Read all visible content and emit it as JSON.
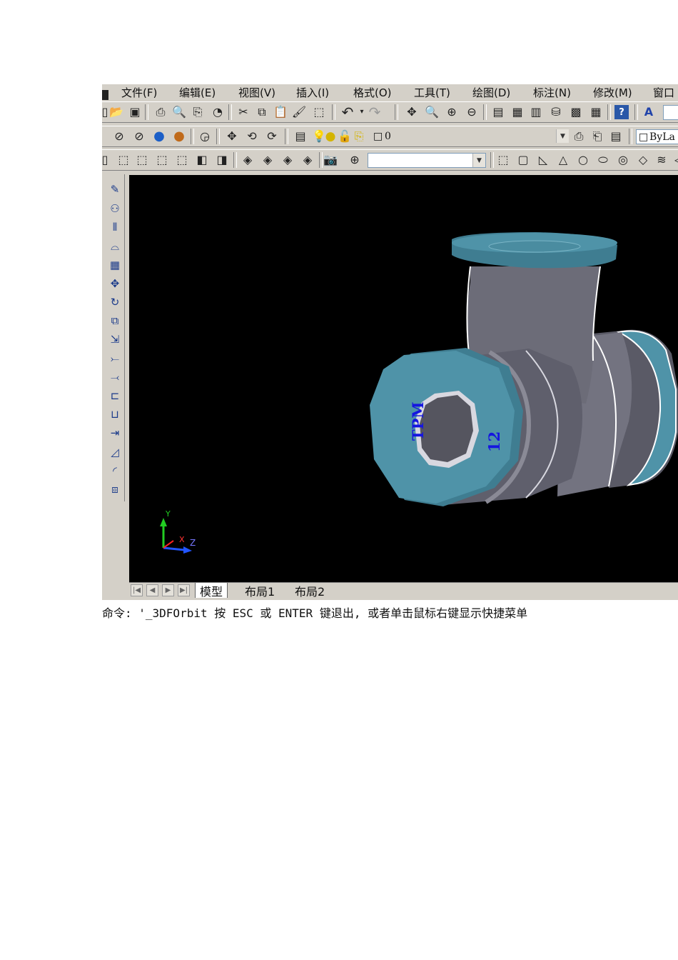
{
  "menu": {
    "items": [
      "文件(F)",
      "编辑(E)",
      "视图(V)",
      "插入(I)",
      "格式(O)",
      "工具(T)",
      "绘图(D)",
      "标注(N)",
      "修改(M)",
      "窗口"
    ]
  },
  "toolbar2": {
    "layer_value": "0",
    "linetype_value": "ByLa"
  },
  "model": {
    "label_tpm": "TPM",
    "label_size": "12"
  },
  "ucs": {
    "x": "X",
    "y": "Y",
    "z": "Z"
  },
  "tabs": {
    "model": "模型",
    "layout1": "布局1",
    "layout2": "布局2"
  },
  "command": {
    "text": "命令: '_3DFOrbit 按 ESC 或 ENTER 键退出, 或者单击鼠标右键显示快捷菜单"
  },
  "colors": {
    "viewport_bg": "#000000",
    "flange_face": "#4f93a8",
    "pipe_body": "#6c6c78",
    "label_text": "#1515e0"
  }
}
